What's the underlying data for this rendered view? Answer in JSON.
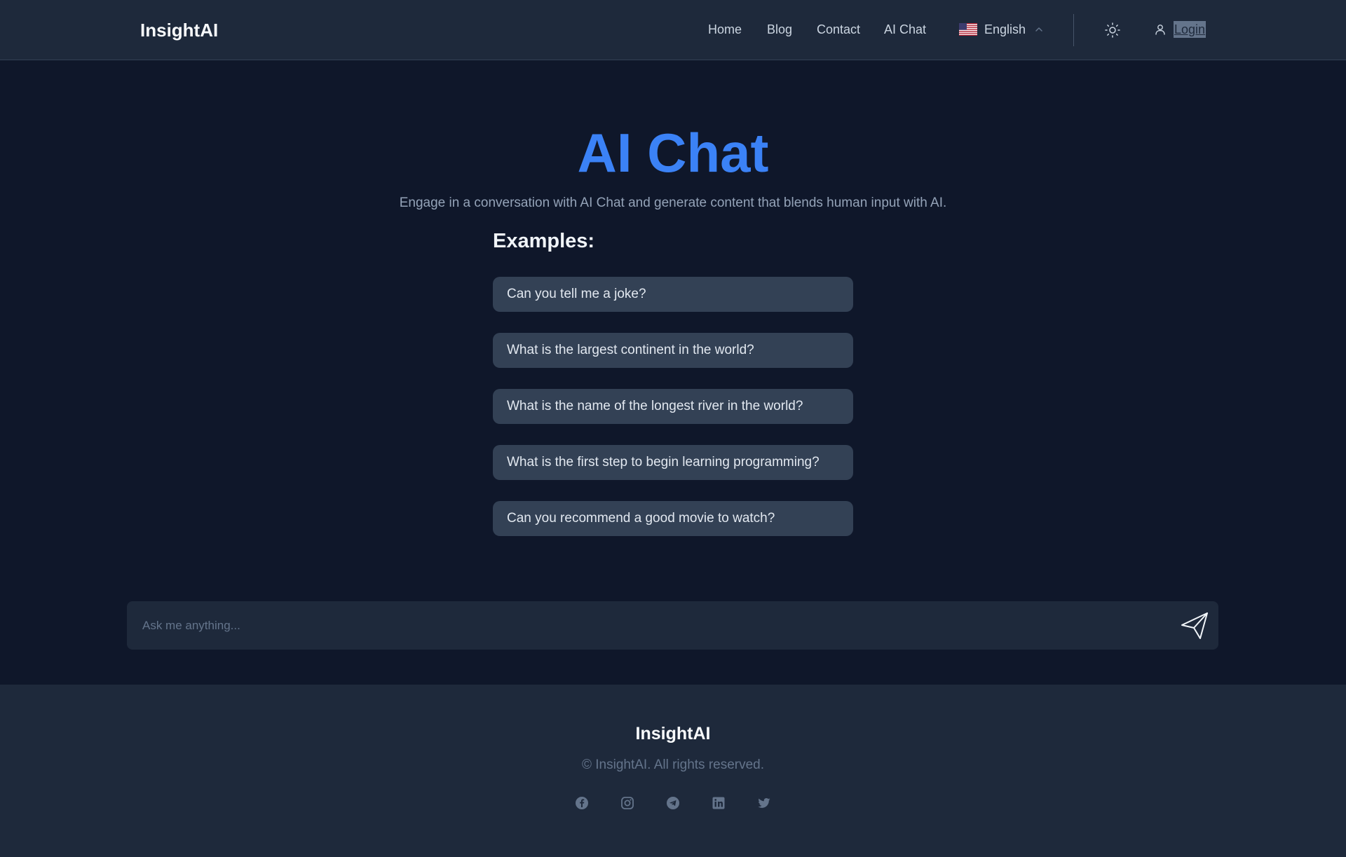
{
  "header": {
    "brand": "InsightAI",
    "nav": [
      {
        "label": "Home"
      },
      {
        "label": "Blog"
      },
      {
        "label": "Contact"
      },
      {
        "label": "AI Chat"
      }
    ],
    "language": {
      "label": "English",
      "flag_icon": "us-flag-icon"
    },
    "theme_toggle_icon": "sun-icon",
    "login": {
      "label": "Login",
      "icon": "user-icon"
    }
  },
  "main": {
    "title": "AI Chat",
    "subtitle": "Engage in a conversation with AI Chat and generate content that blends human input with AI.",
    "examples_heading": "Examples:",
    "examples": [
      "Can you tell me a joke?",
      "What is the largest continent in the world?",
      "What is the name of the longest river in the world?",
      "What is the first step to begin learning programming?",
      "Can you recommend a good movie to watch?"
    ]
  },
  "chat": {
    "placeholder": "Ask me anything...",
    "value": "",
    "send_icon": "send-icon"
  },
  "footer": {
    "brand": "InsightAI",
    "copyright": "© InsightAI. All rights reserved.",
    "socials": [
      "facebook-icon",
      "instagram-icon",
      "telegram-icon",
      "linkedin-icon",
      "twitter-icon"
    ]
  },
  "colors": {
    "background": "#0f172a",
    "surface": "#1e293b",
    "card": "#334155",
    "accent": "#3b82f6",
    "muted": "#94a3b8"
  }
}
